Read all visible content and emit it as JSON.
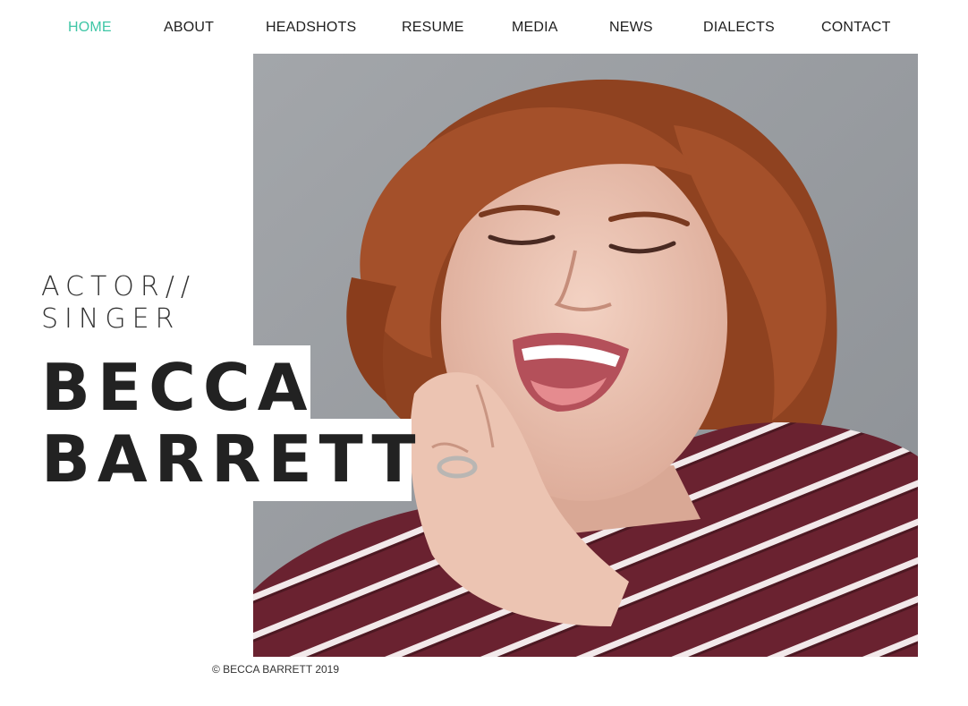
{
  "nav": {
    "items": [
      {
        "label": "HOME",
        "active": true
      },
      {
        "label": "ABOUT",
        "active": false
      },
      {
        "label": "HEADSHOTS",
        "active": false
      },
      {
        "label": "RESUME",
        "active": false
      },
      {
        "label": "MEDIA",
        "active": false
      },
      {
        "label": "NEWS",
        "active": false
      },
      {
        "label": "DIALECTS",
        "active": false
      },
      {
        "label": "CONTACT",
        "active": false
      }
    ],
    "active_color": "#3fc6a6",
    "text_color": "#1e1e1e"
  },
  "hero": {
    "tagline_line1": "ACTOR//",
    "tagline_line2": "SINGER",
    "name_line1": "BECCA",
    "name_line2": "BARRETT",
    "photo": {
      "subject": "headshot-photo",
      "background_color": "#9b9ea2",
      "hair_color": "#9a4a22",
      "shirt_color": "#6a2230"
    }
  },
  "footer": {
    "copyright": "© BECCA BARRETT 2019"
  }
}
